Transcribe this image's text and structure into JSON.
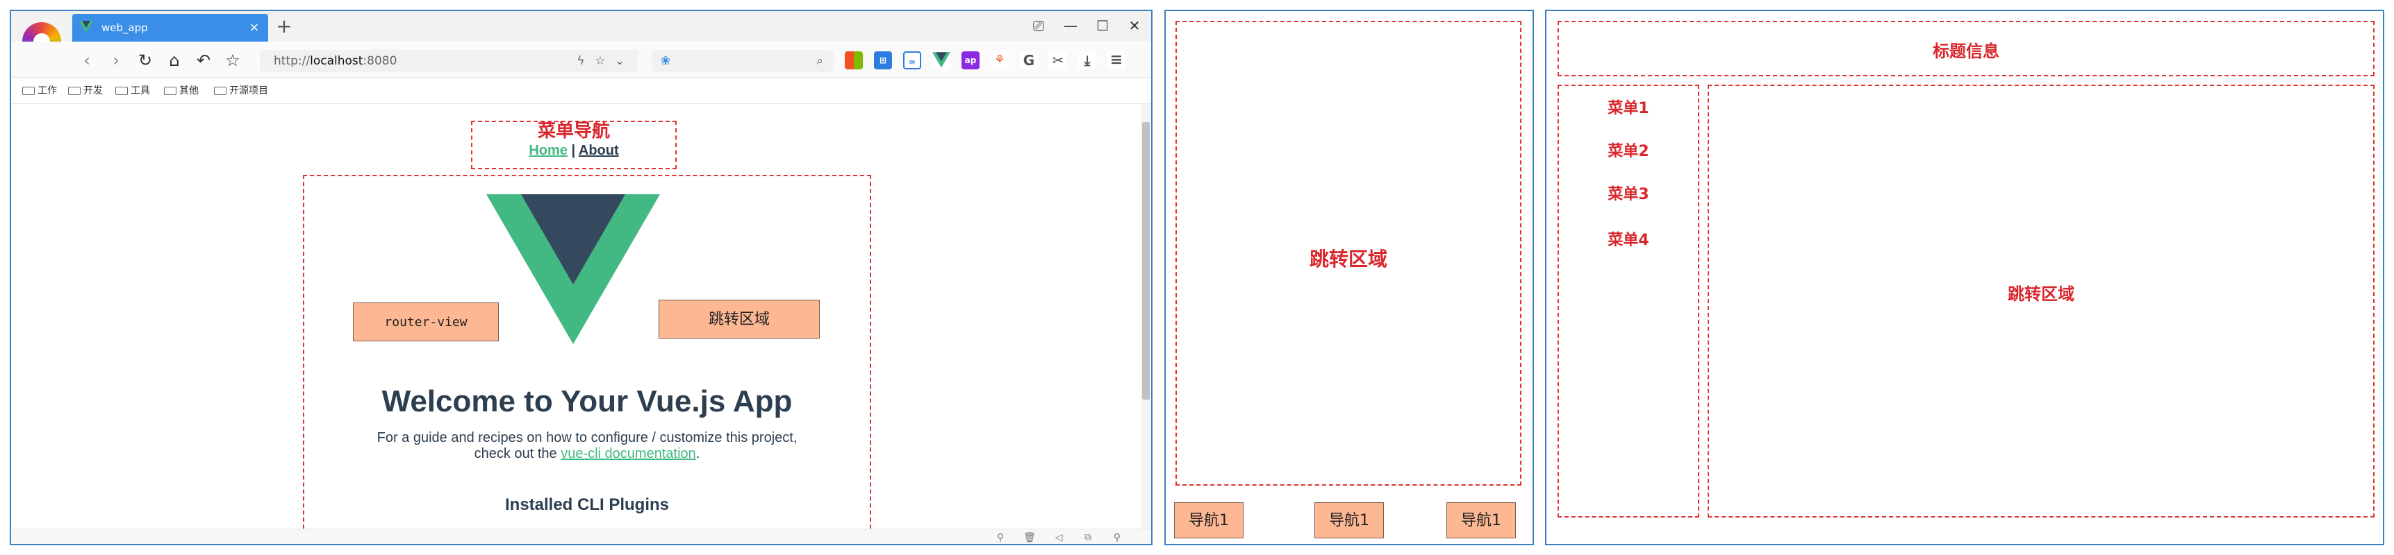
{
  "browser": {
    "tab_title": "web_app",
    "tab_close": "×",
    "new_tab": "+",
    "window_controls": [
      "⎚",
      "—",
      "☐",
      "✕"
    ],
    "address_prefix": "http://",
    "address_host": "localhost",
    "address_port": ":8080",
    "bookmarks": [
      "工作",
      "开发",
      "工具",
      "其他",
      "开源项目"
    ],
    "accent": "#3b8ee8"
  },
  "app": {
    "menu_label": "菜单导航",
    "link_home": "Home",
    "link_separator": " | ",
    "link_about": "About",
    "router_view_tag": "router-view",
    "jump_area_tag": "跳转区域",
    "welcome": "Welcome to Your Vue.js App",
    "guide_line1": "For a guide and recipes on how to configure / customize this project,",
    "guide_line2_prefix": "check out the ",
    "guide_link": "vue-cli documentation",
    "guide_line2_suffix": ".",
    "plugins_heading": "Installed CLI Plugins",
    "vue_green": "#42b983",
    "vue_dark": "#35495e"
  },
  "layout2": {
    "area_label": "跳转区域",
    "nav_buttons": [
      "导航1",
      "导航1",
      "导航1"
    ]
  },
  "layout3": {
    "title": "标题信息",
    "menu_items": [
      "菜单1",
      "菜单2",
      "菜单3",
      "菜单4"
    ],
    "main_label": "跳转区域"
  }
}
